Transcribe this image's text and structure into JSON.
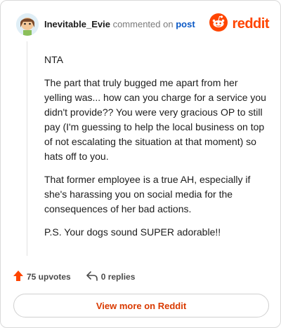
{
  "header": {
    "username": "Inevitable_Evie",
    "commented_text": "commented on",
    "post_link": "post",
    "brand": "reddit"
  },
  "comment": {
    "paragraphs": [
      "NTA",
      "The part that truly bugged me apart from her yelling was... how can you charge for a service you didn't provide?? You were very gracious OP to still pay (I'm guessing to help the local business on top of not escalating the situation at that moment) so hats off to you.",
      "That former employee is a true AH, especially if she's harassing you on social media for the consequences of her bad actions.",
      "P.S. Your dogs sound SUPER adorable!!"
    ]
  },
  "actions": {
    "upvotes": "75 upvotes",
    "replies": "0 replies"
  },
  "footer": {
    "view_more": "View more on Reddit"
  },
  "colors": {
    "brand": "#ff4500",
    "link": "#0b59c6",
    "view_more": "#d93a00",
    "upvote": "#ff4500"
  },
  "icons": [
    "avatar",
    "reddit-logo-icon",
    "upvote-arrow-icon",
    "reply-icon"
  ]
}
